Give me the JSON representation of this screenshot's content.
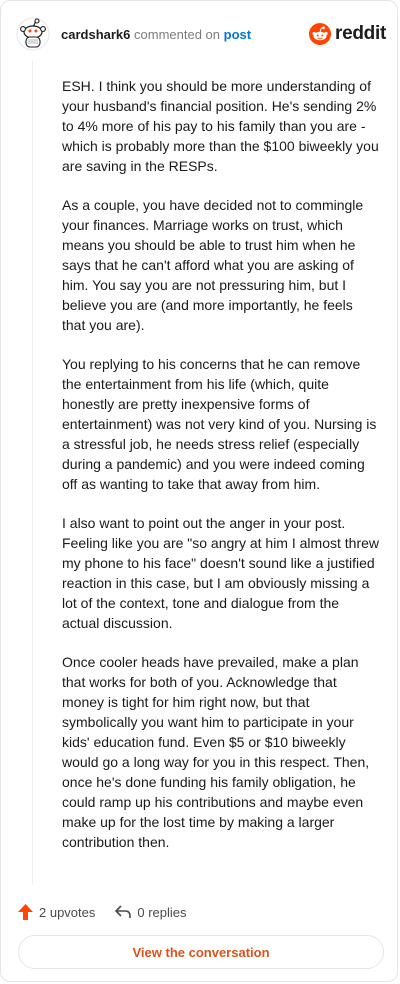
{
  "header": {
    "username": "cardshark6",
    "commented_on": "commented on",
    "post_link": "post",
    "brand": "reddit"
  },
  "comment": {
    "paragraphs": [
      "ESH. I think you should be more understanding of your husband's financial position. He's sending 2% to 4% more of his pay to his family than you are - which is probably more than the $100 biweekly you are saving in the RESPs.",
      "As a couple, you have decided not to commingle your finances. Marriage works on trust, which means you should be able to trust him when he says that he can't afford what you are asking of him. You say you are not pressuring him, but I believe you are (and more importantly, he feels that you are).",
      "You replying to his concerns that he can remove the entertainment from his life (which, quite honestly are pretty inexpensive forms of entertainment) was not very kind of you. Nursing is a stressful job, he needs stress relief (especially during a pandemic) and you were indeed coming off as wanting to take that away from him.",
      "I also want to point out the anger in your post. Feeling like you are \"so angry at him I almost threw my phone to his face\" doesn't sound like a justified reaction in this case, but I am obviously missing a lot of the context, tone and dialogue from the actual discussion.",
      "Once cooler heads have prevailed, make a plan that works for both of you. Acknowledge that money is tight for him right now, but that symbolically you want him to participate in your kids' education fund. Even $5 or $10 biweekly would go a long way for you in this respect. Then, once he's done funding his family obligation, he could ramp up his contributions and maybe even make up for the lost time by making a larger contribution then."
    ]
  },
  "actions": {
    "upvotes": "2 upvotes",
    "replies": "0 replies",
    "view_conversation": "View the conversation"
  },
  "icons": {
    "avatar": "snoo-avatar-icon",
    "logo": "reddit-logo-icon",
    "upvote": "upvote-arrow-icon",
    "reply": "reply-arrow-icon"
  },
  "colors": {
    "accent": "#ff4500",
    "link": "#0079d3",
    "button_text": "#d9531e"
  }
}
